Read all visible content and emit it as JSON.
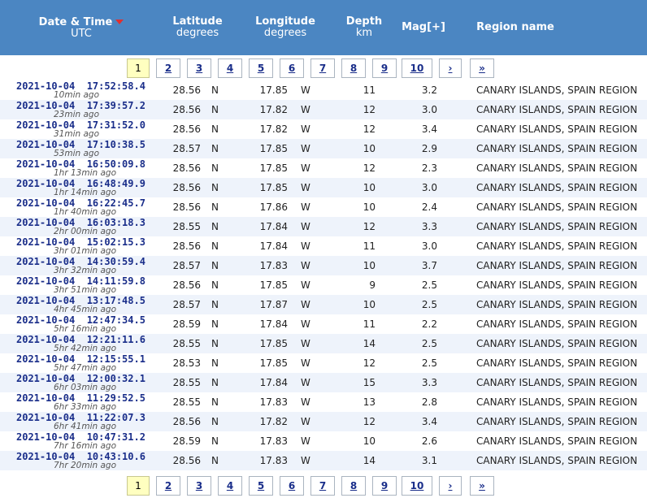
{
  "header": {
    "date_title": "Date & Time",
    "date_sub": "UTC",
    "lat_title": "Latitude",
    "lat_sub": "degrees",
    "lon_title": "Longitude",
    "lon_sub": "degrees",
    "depth_title": "Depth",
    "depth_sub": "km",
    "mag_title": "Mag[+]",
    "region_title": "Region name",
    "sort_icon": "sort-down-icon",
    "sort_color": "#e03030",
    "bg_color": "#4b86c2"
  },
  "pager": {
    "pages": [
      "1",
      "2",
      "3",
      "4",
      "5",
      "6",
      "7",
      "8",
      "9",
      "10"
    ],
    "next": "›",
    "last": "»",
    "current": "1"
  },
  "rows": [
    {
      "date": "2021-10-04",
      "time": "17:52:58.4",
      "ago": "10min ago",
      "lat": "28.56",
      "ns": "N",
      "lon": "17.85",
      "ew": "W",
      "depth": "11",
      "mag": "3.2",
      "region": "CANARY ISLANDS, SPAIN REGION"
    },
    {
      "date": "2021-10-04",
      "time": "17:39:57.2",
      "ago": "23min ago",
      "lat": "28.56",
      "ns": "N",
      "lon": "17.82",
      "ew": "W",
      "depth": "12",
      "mag": "3.0",
      "region": "CANARY ISLANDS, SPAIN REGION"
    },
    {
      "date": "2021-10-04",
      "time": "17:31:52.0",
      "ago": "31min ago",
      "lat": "28.56",
      "ns": "N",
      "lon": "17.82",
      "ew": "W",
      "depth": "12",
      "mag": "3.4",
      "region": "CANARY ISLANDS, SPAIN REGION"
    },
    {
      "date": "2021-10-04",
      "time": "17:10:38.5",
      "ago": "53min ago",
      "lat": "28.57",
      "ns": "N",
      "lon": "17.85",
      "ew": "W",
      "depth": "10",
      "mag": "2.9",
      "region": "CANARY ISLANDS, SPAIN REGION"
    },
    {
      "date": "2021-10-04",
      "time": "16:50:09.8",
      "ago": "1hr 13min ago",
      "lat": "28.56",
      "ns": "N",
      "lon": "17.85",
      "ew": "W",
      "depth": "12",
      "mag": "2.3",
      "region": "CANARY ISLANDS, SPAIN REGION"
    },
    {
      "date": "2021-10-04",
      "time": "16:48:49.9",
      "ago": "1hr 14min ago",
      "lat": "28.56",
      "ns": "N",
      "lon": "17.85",
      "ew": "W",
      "depth": "10",
      "mag": "3.0",
      "region": "CANARY ISLANDS, SPAIN REGION"
    },
    {
      "date": "2021-10-04",
      "time": "16:22:45.7",
      "ago": "1hr 40min ago",
      "lat": "28.56",
      "ns": "N",
      "lon": "17.86",
      "ew": "W",
      "depth": "10",
      "mag": "2.4",
      "region": "CANARY ISLANDS, SPAIN REGION"
    },
    {
      "date": "2021-10-04",
      "time": "16:03:18.3",
      "ago": "2hr 00min ago",
      "lat": "28.55",
      "ns": "N",
      "lon": "17.84",
      "ew": "W",
      "depth": "12",
      "mag": "3.3",
      "region": "CANARY ISLANDS, SPAIN REGION"
    },
    {
      "date": "2021-10-04",
      "time": "15:02:15.3",
      "ago": "3hr 01min ago",
      "lat": "28.56",
      "ns": "N",
      "lon": "17.84",
      "ew": "W",
      "depth": "11",
      "mag": "3.0",
      "region": "CANARY ISLANDS, SPAIN REGION"
    },
    {
      "date": "2021-10-04",
      "time": "14:30:59.4",
      "ago": "3hr 32min ago",
      "lat": "28.57",
      "ns": "N",
      "lon": "17.83",
      "ew": "W",
      "depth": "10",
      "mag": "3.7",
      "region": "CANARY ISLANDS, SPAIN REGION"
    },
    {
      "date": "2021-10-04",
      "time": "14:11:59.8",
      "ago": "3hr 51min ago",
      "lat": "28.56",
      "ns": "N",
      "lon": "17.85",
      "ew": "W",
      "depth": "9",
      "mag": "2.5",
      "region": "CANARY ISLANDS, SPAIN REGION"
    },
    {
      "date": "2021-10-04",
      "time": "13:17:48.5",
      "ago": "4hr 45min ago",
      "lat": "28.57",
      "ns": "N",
      "lon": "17.87",
      "ew": "W",
      "depth": "10",
      "mag": "2.5",
      "region": "CANARY ISLANDS, SPAIN REGION"
    },
    {
      "date": "2021-10-04",
      "time": "12:47:34.5",
      "ago": "5hr 16min ago",
      "lat": "28.59",
      "ns": "N",
      "lon": "17.84",
      "ew": "W",
      "depth": "11",
      "mag": "2.2",
      "region": "CANARY ISLANDS, SPAIN REGION"
    },
    {
      "date": "2021-10-04",
      "time": "12:21:11.6",
      "ago": "5hr 42min ago",
      "lat": "28.55",
      "ns": "N",
      "lon": "17.85",
      "ew": "W",
      "depth": "14",
      "mag": "2.5",
      "region": "CANARY ISLANDS, SPAIN REGION"
    },
    {
      "date": "2021-10-04",
      "time": "12:15:55.1",
      "ago": "5hr 47min ago",
      "lat": "28.53",
      "ns": "N",
      "lon": "17.85",
      "ew": "W",
      "depth": "12",
      "mag": "2.5",
      "region": "CANARY ISLANDS, SPAIN REGION"
    },
    {
      "date": "2021-10-04",
      "time": "12:00:32.1",
      "ago": "6hr 03min ago",
      "lat": "28.55",
      "ns": "N",
      "lon": "17.84",
      "ew": "W",
      "depth": "15",
      "mag": "3.3",
      "region": "CANARY ISLANDS, SPAIN REGION"
    },
    {
      "date": "2021-10-04",
      "time": "11:29:52.5",
      "ago": "6hr 33min ago",
      "lat": "28.55",
      "ns": "N",
      "lon": "17.83",
      "ew": "W",
      "depth": "13",
      "mag": "2.8",
      "region": "CANARY ISLANDS, SPAIN REGION"
    },
    {
      "date": "2021-10-04",
      "time": "11:22:07.3",
      "ago": "6hr 41min ago",
      "lat": "28.56",
      "ns": "N",
      "lon": "17.82",
      "ew": "W",
      "depth": "12",
      "mag": "3.4",
      "region": "CANARY ISLANDS, SPAIN REGION"
    },
    {
      "date": "2021-10-04",
      "time": "10:47:31.2",
      "ago": "7hr 16min ago",
      "lat": "28.59",
      "ns": "N",
      "lon": "17.83",
      "ew": "W",
      "depth": "10",
      "mag": "2.6",
      "region": "CANARY ISLANDS, SPAIN REGION"
    },
    {
      "date": "2021-10-04",
      "time": "10:43:10.6",
      "ago": "7hr 20min ago",
      "lat": "28.56",
      "ns": "N",
      "lon": "17.83",
      "ew": "W",
      "depth": "14",
      "mag": "3.1",
      "region": "CANARY ISLANDS, SPAIN REGION"
    }
  ]
}
